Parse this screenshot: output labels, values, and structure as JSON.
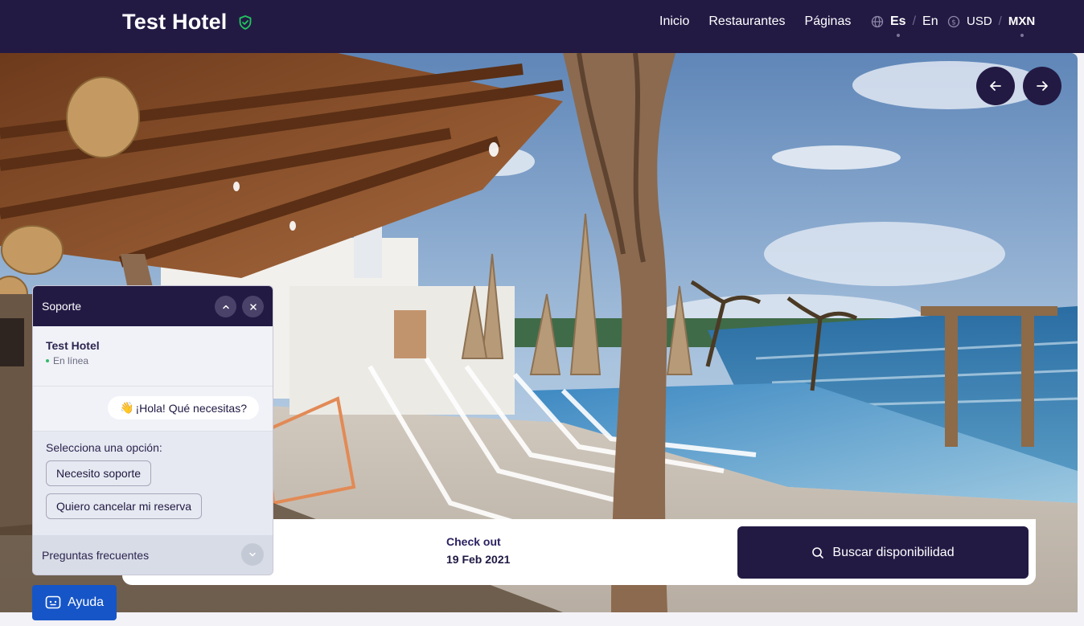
{
  "header": {
    "brand": "Test Hotel",
    "nav": [
      "Inicio",
      "Restaurantes",
      "Páginas"
    ],
    "languages": [
      "Es",
      "En"
    ],
    "language_sep": "/",
    "currencies": [
      "USD",
      "MXN"
    ],
    "currency_sep": "/"
  },
  "hero": {
    "prev_icon": "arrow-left-icon",
    "next_icon": "arrow-right-icon"
  },
  "booking": {
    "checkout_label": "Check out",
    "checkout_value": "19 Feb 2021",
    "search_label": "Buscar disponibilidad"
  },
  "chat": {
    "title": "Soporte",
    "org_name": "Test Hotel",
    "status": "En línea",
    "greeting_emoji": "👋",
    "greeting": "¡Hola! Qué necesitas?",
    "prompt": "Selecciona una opción:",
    "options": [
      "Necesito soporte",
      "Quiero cancelar mi reserva"
    ],
    "faq": "Preguntas frecuentes"
  },
  "help_button": {
    "label": "Ayuda"
  },
  "colors": {
    "primary": "#231a44",
    "help_blue": "#1655c7",
    "online_green": "#35b96a",
    "badge_green": "#22c55e"
  }
}
